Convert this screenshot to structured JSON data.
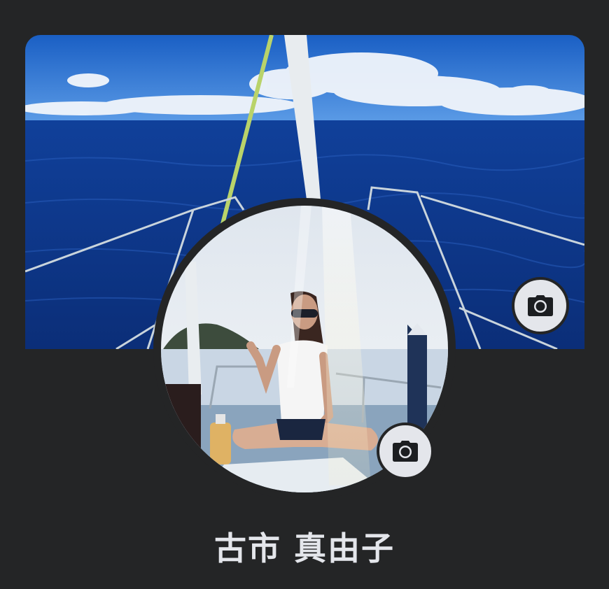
{
  "profile": {
    "name": "古市 真由子",
    "cover_photo": {
      "alt": ""
    },
    "profile_photo": {
      "alt": ""
    }
  },
  "buttons": {
    "edit_cover_icon": "camera-icon",
    "edit_profile_photo_icon": "camera-icon"
  },
  "colors": {
    "background": "#242526",
    "button_bg": "#e4e6eb",
    "icon": "#1c1e21",
    "text": "#e4e6eb"
  }
}
